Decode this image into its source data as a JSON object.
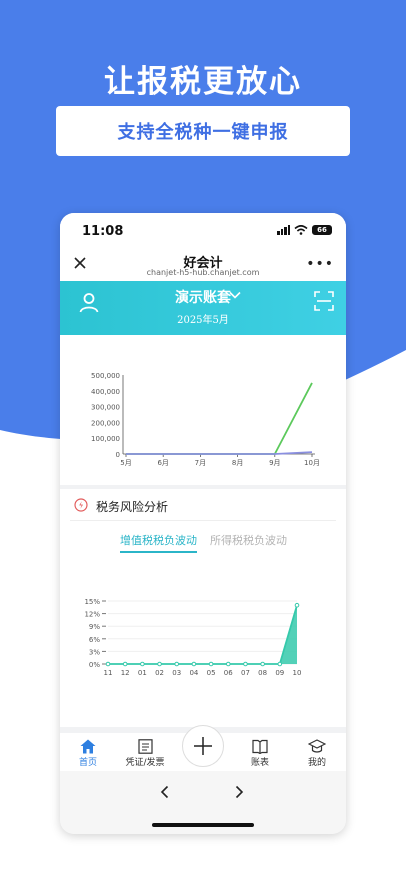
{
  "promo": {
    "headline": "让报税更放心",
    "subtitle": "支持全税种一键申报",
    "colors": {
      "background_blue": "#4a7eea",
      "accent_teal": "#2bb5c8",
      "nav_active": "#2e7fe0"
    }
  },
  "status_bar": {
    "time": "11:08",
    "battery": "66"
  },
  "navbar": {
    "title": "好会计",
    "url": "chanjet-h5-hub.chanjet.com",
    "close_icon": "close-icon",
    "more_icon": "more-icon"
  },
  "hero": {
    "company": "演示账套",
    "period": "2025年5月",
    "left_icon": "user-icon",
    "right_icon": "scan-icon"
  },
  "risk_section": {
    "title": "税务风险分析",
    "tabs": [
      {
        "label": "增值税税负波动",
        "active": true
      },
      {
        "label": "所得税税负波动",
        "active": false
      }
    ]
  },
  "chart_data": [
    {
      "type": "line",
      "categories": [
        "5月",
        "6月",
        "7月",
        "8月",
        "9月",
        "10月"
      ],
      "ylim": [
        0,
        500000
      ],
      "yticks": [
        "0",
        "100,000",
        "200,000",
        "300,000",
        "400,000",
        "500,000"
      ],
      "series": [
        {
          "color": "#5cc95c",
          "values": [
            0,
            0,
            0,
            0,
            0,
            450000
          ]
        },
        {
          "color": "#8a8fe0",
          "values": [
            0,
            0,
            0,
            0,
            0,
            12000
          ]
        }
      ]
    },
    {
      "type": "area",
      "categories": [
        "11",
        "12",
        "01",
        "02",
        "03",
        "04",
        "05",
        "06",
        "07",
        "08",
        "09",
        "10"
      ],
      "ylim": [
        0,
        15
      ],
      "yticks": [
        "0%",
        "3%",
        "6%",
        "9%",
        "12%",
        "15%"
      ],
      "series": [
        {
          "color": "#35c9ab",
          "values": [
            0,
            0,
            0,
            0,
            0,
            0,
            0,
            0,
            0,
            0,
            0,
            14
          ]
        }
      ]
    }
  ],
  "tabbar": {
    "items": [
      {
        "label": "首页",
        "icon": "home-icon",
        "active": true
      },
      {
        "label": "凭证/发票",
        "icon": "document-icon",
        "active": false
      },
      {
        "label": "",
        "icon": "plus-icon",
        "active": false
      },
      {
        "label": "账表",
        "icon": "book-icon",
        "active": false
      },
      {
        "label": "我的",
        "icon": "graduation-cap-icon",
        "active": false
      }
    ]
  },
  "browser_nav": {
    "back_icon": "chevron-left-icon",
    "forward_icon": "chevron-right-icon"
  }
}
